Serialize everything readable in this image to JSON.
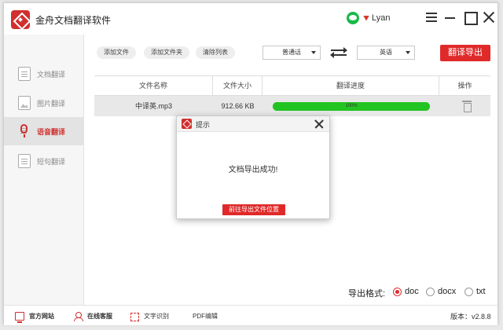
{
  "app": {
    "title": "金舟文档翻译软件",
    "username": "Lyan",
    "version": "版本：v2.8.8"
  },
  "sidebar": {
    "items": [
      {
        "label": "文档翻译",
        "icon": "document-icon"
      },
      {
        "label": "图片翻译",
        "icon": "image-icon"
      },
      {
        "label": "语音翻译",
        "icon": "microphone-icon",
        "active": true
      },
      {
        "label": "短句翻译",
        "icon": "text-icon"
      }
    ]
  },
  "toolbar": {
    "add_file": "添加文件",
    "add_folder": "添加文件夹",
    "clear_list": "清除列表",
    "source_lang": "普通话",
    "target_lang": "英语",
    "export_button": "翻译导出"
  },
  "table": {
    "headers": [
      "文件名称",
      "文件大小",
      "翻译进度",
      "操作"
    ],
    "rows": [
      {
        "name": "中译英.mp3",
        "size": "912.66 KB",
        "progress_text": "100%",
        "progress": 1.0
      }
    ]
  },
  "dialog": {
    "title": "提示",
    "message": "文档导出成功!",
    "button": "前往导出文件位置"
  },
  "export_format": {
    "label": "导出格式:",
    "options": [
      "doc",
      "docx",
      "txt"
    ],
    "selected": "doc"
  },
  "footer": {
    "official_site": "官方网站",
    "online_service": "在线客服",
    "ocr": "文字识别",
    "pdf_edit": "PDF编辑"
  },
  "colors": {
    "accent": "#e02a2a",
    "progress": "#22c422"
  }
}
